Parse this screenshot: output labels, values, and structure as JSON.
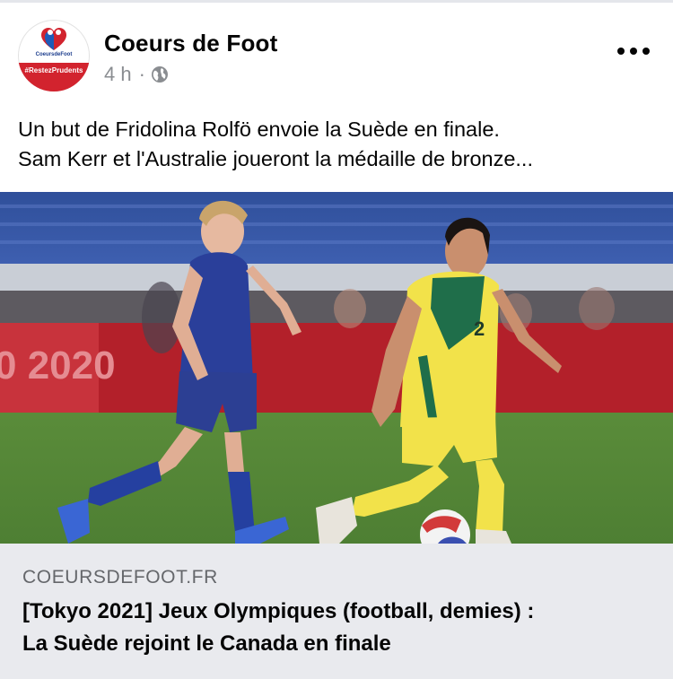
{
  "post": {
    "page_name": "Coeurs de Foot",
    "time": "4 h",
    "separator": "·",
    "avatar_band_text": "#RestezPrudents",
    "avatar_logo_text": "CoeursdeFoot",
    "text_lines": [
      "Un but de Fridolina Rolfö envoie la Suède en finale.",
      "Sam Kerr et l'Australie joueront la médaille de bronze..."
    ],
    "photo_banner_text": "0 2020",
    "player_number": "2"
  },
  "link_preview": {
    "domain": "COEURSDEFOOT.FR",
    "title_lines": [
      "[Tokyo 2021] Jeux Olympiques (football, demies) :",
      "La Suède rejoint le Canada en finale"
    ]
  },
  "icons": {
    "privacy": "globe-icon",
    "menu": "more-options-icon"
  },
  "colors": {
    "brand_red": "#d2232e",
    "meta_gray": "#8a8d91",
    "link_bg": "#e9eaee"
  }
}
